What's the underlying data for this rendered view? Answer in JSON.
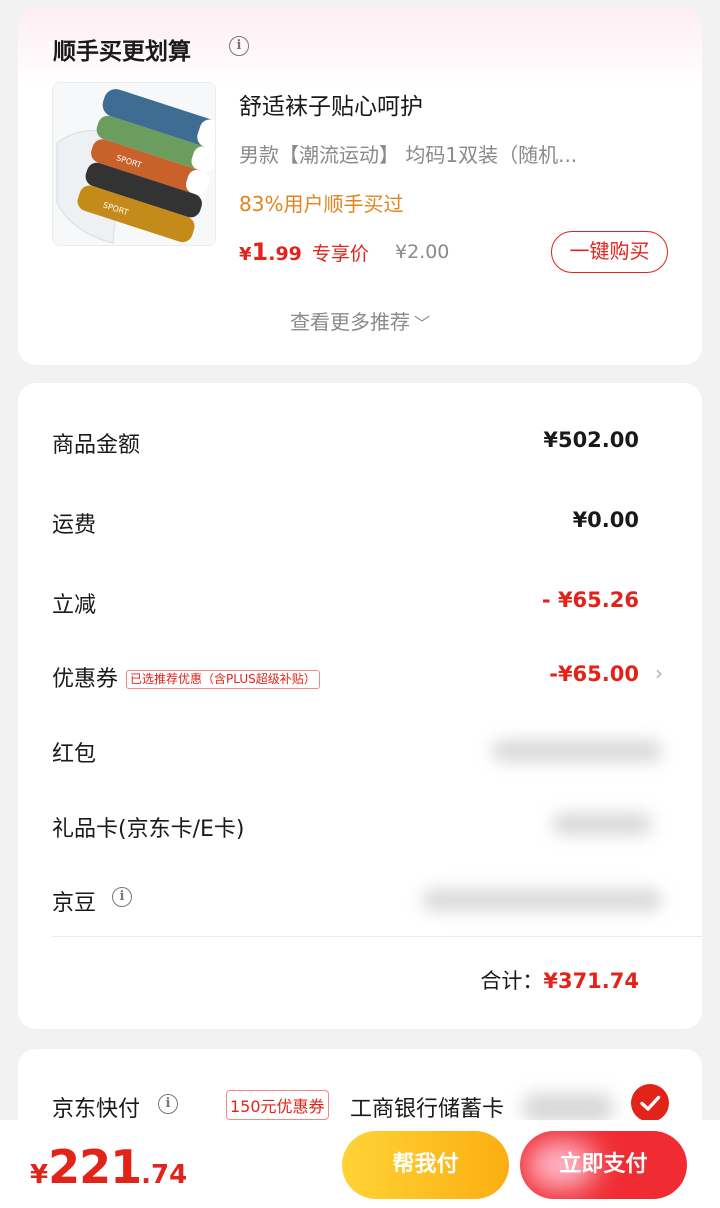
{
  "recommend": {
    "title": "顺手买更划算",
    "product": {
      "name": "舒适袜子贴心呵护",
      "spec": "男款【潮流运动】  均码1双装（随机...",
      "buyers": "83%用户顺手买过",
      "price_currency": "¥",
      "price_int": "1",
      "price_dec": ".99",
      "price_tag": "专享价",
      "original_price": "¥2.00",
      "sock_print": "SPORT"
    },
    "buy_button": "一键购买",
    "more": "查看更多推荐",
    "more_icon": "chevron-down-icon"
  },
  "summary": {
    "rows": [
      {
        "label": "商品金额",
        "value": "¥502.00"
      },
      {
        "label": "运费",
        "value": "¥0.00"
      },
      {
        "label": "立减",
        "value": "- ¥65.26"
      },
      {
        "label": "优惠券",
        "tag": "已选推荐优惠（含PLUS超级补贴）",
        "value": "-¥65.00"
      },
      {
        "label": "红包",
        "value": ""
      },
      {
        "label": "礼品卡(京东卡/E卡)",
        "value": ""
      },
      {
        "label": "京豆",
        "value": ""
      }
    ],
    "total_label": "合计：",
    "total_value": "¥371.74"
  },
  "payment": {
    "method": "京东快付",
    "coupon": "150元优惠券",
    "bank": "工商银行储蓄卡"
  },
  "bottom": {
    "currency": "¥",
    "amount_int": "221",
    "amount_dec": ".74",
    "help_pay": "帮我付",
    "pay_now": "立即支付"
  },
  "colors": {
    "accent_red": "#e2231a",
    "buyers_orange": "#e0851e",
    "help_yellow": "#fcae10",
    "pay_red": "#f02c32"
  }
}
